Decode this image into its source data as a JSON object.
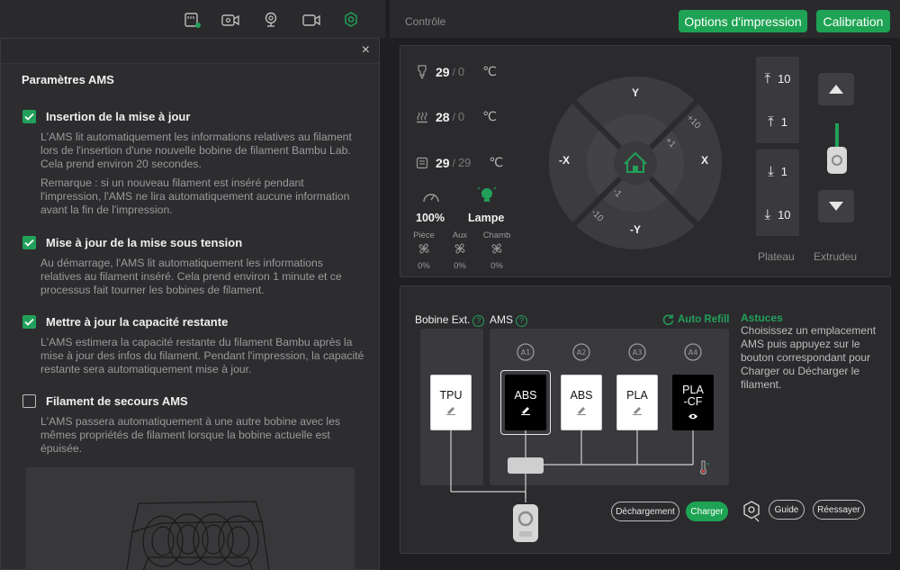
{
  "toolbar": {
    "icons": [
      "sd-card-icon",
      "camera-record-icon",
      "webcam-icon",
      "video-icon",
      "settings-icon"
    ],
    "colors": {
      "accent": "#22a05a"
    }
  },
  "dialog": {
    "close_label": "×",
    "title": "Paramètres AMS",
    "options": [
      {
        "title": "Insertion de la mise à jour",
        "checked": true,
        "desc1": "L'AMS lit automatiquement les informations relatives au filament lors de l'insertion d'une nouvelle bobine de filament Bambu Lab. Cela prend environ 20 secondes.",
        "desc2": "Remarque : si un nouveau filament est inséré pendant l'impression, l'AMS ne lira automatiquement aucune information avant la fin de l'impression."
      },
      {
        "title": "Mise à jour de la mise sous tension",
        "checked": true,
        "desc1": "Au démarrage, l'AMS lit automatiquement les informations relatives au filament inséré. Cela prend environ 1 minute et ce processus fait tourner les bobines de filament."
      },
      {
        "title": "Mettre à jour la capacité restante",
        "checked": true,
        "desc1": "L'AMS estimera la capacité restante du filament Bambu après la mise à jour des infos du filament. Pendant l'impression, la capacité restante sera automatiquement mise à jour."
      },
      {
        "title": "Filament de secours AMS",
        "checked": false,
        "desc1": "L'AMS passera automatiquement à une autre bobine avec les mêmes propriétés de filament lorsque la bobine actuelle est épuisée."
      }
    ]
  },
  "header": {
    "section": "Contrôle",
    "print_options": "Options d'impression",
    "calibration": "Calibration"
  },
  "temps": {
    "nozzle": {
      "current": "29",
      "target": "0"
    },
    "bed": {
      "current": "28",
      "target": "0"
    },
    "chamber": {
      "current": "29",
      "target": "29"
    },
    "separator": "/",
    "unit": "℃"
  },
  "status": {
    "speed": "100%",
    "lamp": "Lampe",
    "fans": [
      {
        "name": "Pièce",
        "value": "0%"
      },
      {
        "name": "Aux",
        "value": "0%"
      },
      {
        "name": "Chamb",
        "value": "0%"
      }
    ]
  },
  "jog": {
    "y_plus": "Y",
    "y_minus": "-Y",
    "x_plus": "X",
    "x_minus": "-X",
    "step_small": "+1",
    "step_big": "+10",
    "step_small_neg": "-1",
    "step_big_neg": "-10"
  },
  "z_axis": {
    "up_10": "10",
    "up_1": "1",
    "down_1": "1",
    "down_10": "10",
    "label": "Plateau"
  },
  "extruder": {
    "label": "Extrudeu"
  },
  "ams": {
    "ext_label": "Bobine Ext.",
    "ams_label": "AMS",
    "help": "?",
    "auto_refill": "Auto Refill",
    "ext_slot": "TPU",
    "slots": [
      {
        "id": "A1",
        "material": "ABS"
      },
      {
        "id": "A2",
        "material": "ABS"
      },
      {
        "id": "A3",
        "material": "PLA"
      },
      {
        "id": "A4",
        "material_line1": "PLA",
        "material_line2": "-CF"
      }
    ],
    "tips_title": "Astuces",
    "tips_text": "Choisissez un emplacement AMS puis appuyez sur le bouton correspondant pour Charger ou Décharger le filament.",
    "unload": "Déchargement",
    "load": "Charger",
    "guide": "Guide",
    "retry": "Réessayer"
  }
}
